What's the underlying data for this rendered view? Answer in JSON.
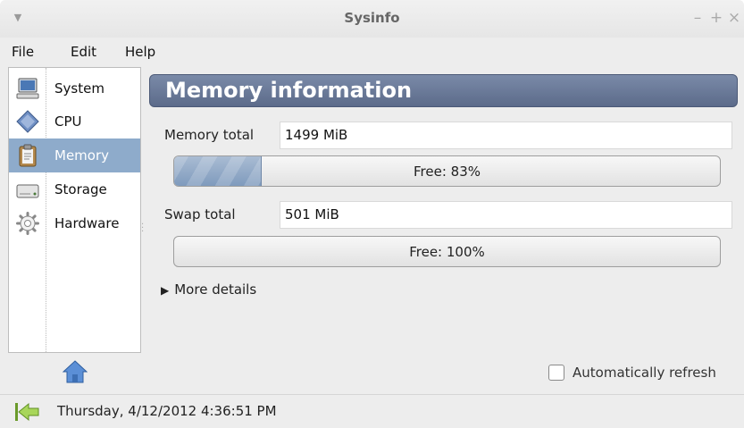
{
  "window": {
    "title": "Sysinfo",
    "minimize_glyph": "–",
    "maximize_glyph": "+",
    "close_glyph": "×",
    "menu_glyph": "▼"
  },
  "menubar": {
    "items": [
      "File",
      "Edit",
      "Help"
    ]
  },
  "sidebar": {
    "items": [
      {
        "label": "System",
        "icon": "monitor-icon",
        "selected": false
      },
      {
        "label": "CPU",
        "icon": "cpu-icon",
        "selected": false
      },
      {
        "label": "Memory",
        "icon": "clipboard-icon",
        "selected": true
      },
      {
        "label": "Storage",
        "icon": "drive-icon",
        "selected": false
      },
      {
        "label": "Hardware",
        "icon": "gear-icon",
        "selected": false
      }
    ]
  },
  "main": {
    "header": "Memory information",
    "memory": {
      "label": "Memory total",
      "value": "1499 MiB",
      "progress_text": "Free: 83%",
      "used_fraction": 0.16
    },
    "swap": {
      "label": "Swap total",
      "value": "501 MiB",
      "progress_text": "Free: 100%",
      "used_fraction": 0.0
    },
    "more_details": "More details"
  },
  "toolbar": {
    "home_icon": "home-icon",
    "auto_refresh_label": "Automatically refresh",
    "auto_refresh_checked": false
  },
  "statusbar": {
    "icon": "back-arrow-icon",
    "text": "Thursday, 4/12/2012 4:36:51 PM"
  },
  "colors": {
    "accent_selected": "#8eabcb",
    "header_bg": "#66759a",
    "progress_fill": "#8ea6c6"
  }
}
